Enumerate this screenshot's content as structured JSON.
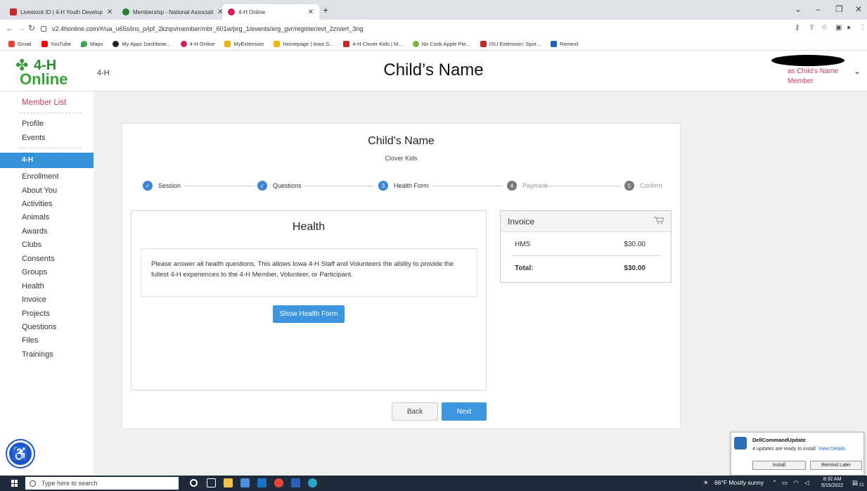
{
  "browser": {
    "tabs": [
      {
        "title": "Livestock ID | 4-H Youth Develop",
        "active": false
      },
      {
        "title": "Membership - National Associati",
        "active": false
      },
      {
        "title": "4-H Online",
        "active": true
      }
    ],
    "url": "v2.4honline.com/#/ua_u65s/ins_p/ipf_2kzqn/member/mbr_601w/prg_1/events/erg_gvr/register/evt_2zn/ert_3ng",
    "bookmarks": [
      "Gmail",
      "YouTube",
      "Maps",
      "My Apps Dashboar...",
      "4-H Online",
      "MyExtension",
      "Homepage | Iowa S...",
      "4-H Clover Kids | M...",
      "No Cook Apple Pie...",
      "ISU Extension: Spor...",
      "Remind"
    ]
  },
  "header": {
    "logo_top": "4-H",
    "logo_bottom": "Online",
    "program": "4-H",
    "title": "Child’s Name",
    "as_user": "as Child's Name",
    "role": "Member"
  },
  "sidebar": {
    "member_list": "Member List",
    "top_items": [
      "Profile",
      "Events"
    ],
    "section": "4-H",
    "items": [
      "Enrollment",
      "About You",
      "Activities",
      "Animals",
      "Awards",
      "Clubs",
      "Consents",
      "Groups",
      "Health",
      "Invoice",
      "Projects",
      "Questions",
      "Files",
      "Trainings"
    ]
  },
  "card": {
    "name": "Child's Name",
    "subtitle": "Clover Kids",
    "steps": [
      {
        "label": "Session",
        "status": "done",
        "number": ""
      },
      {
        "label": "Questions",
        "status": "done",
        "number": ""
      },
      {
        "label": "Health Form",
        "status": "current",
        "number": "3"
      },
      {
        "label": "Payment",
        "status": "todo",
        "number": "4"
      },
      {
        "label": "Confirm",
        "status": "todo",
        "number": "5"
      }
    ],
    "health": {
      "title": "Health",
      "note": "Please answer all health questions.  This allows Iowa 4-H Staff and Volunteers the ability to provide the fullest 4-H experiences to the 4-H Member, Volunteer, or Participant.",
      "show_button": "Show Health Form"
    },
    "back_button": "Back",
    "next_button": "Next"
  },
  "invoice": {
    "title": "Invoice",
    "line_label": "HMS",
    "line_amount": "$30.00",
    "total_label": "Total:",
    "total_amount": "$30.00"
  },
  "notification": {
    "title": "DellCommandUpdate",
    "body": "4 updates are ready to install",
    "link": "View Details",
    "install": "Install",
    "remind": "Remind Later"
  },
  "taskbar": {
    "search_placeholder": "Type here to search",
    "weather": "66°F  Mostly sunny",
    "time": "8:32 AM",
    "date": "9/15/2022",
    "notif_count": "21"
  },
  "colors": {
    "accent_blue": "#3592db",
    "member_pink": "#c0386b",
    "clover_green": "#3a9a3a"
  }
}
